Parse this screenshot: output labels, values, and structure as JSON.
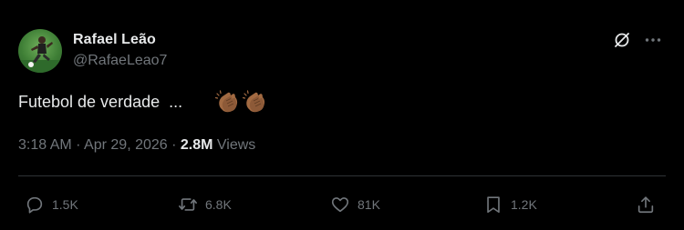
{
  "author": {
    "name": "Rafael Leão",
    "handle": "@RafaeLeao7"
  },
  "tweet": {
    "text": "Futebol de verdade  ...",
    "emojis": [
      "clapping-hands-medium-dark",
      "clapping-hands-medium-dark"
    ]
  },
  "meta": {
    "time": "3:18 AM",
    "sep1": " · ",
    "date": "Apr 29, 2026",
    "sep2": " · ",
    "views_count": "2.8M",
    "views_label": " Views"
  },
  "actions": {
    "replies": "1.5K",
    "reposts": "6.8K",
    "likes": "81K",
    "bookmarks": "1.2K"
  },
  "colors": {
    "background": "#000000",
    "text_primary": "#e7e9ea",
    "text_secondary": "#71767b",
    "divider": "#2f3336"
  }
}
